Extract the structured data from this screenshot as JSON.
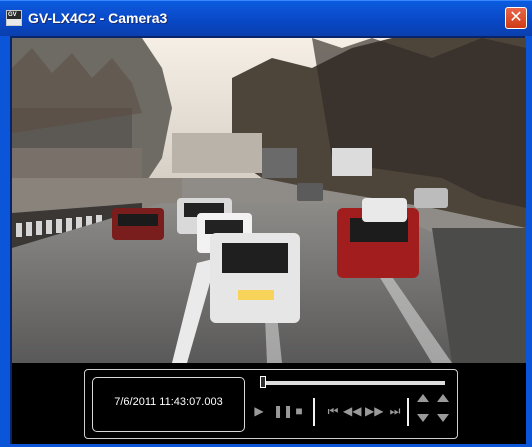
{
  "window": {
    "title": "GV-LX4C2 - Camera3",
    "icon_label": "GV",
    "close_glyph": "✕"
  },
  "video": {
    "description_icon": "video-feed"
  },
  "controls": {
    "timestamp": "7/6/2011 11:43:07.003",
    "progress_fraction": 0.0,
    "buttons": {
      "play": "▶",
      "pause": "❚❚",
      "stop": "■",
      "first_frame": "⏮",
      "rewind": "◀◀",
      "fast_forward": "▶▶",
      "last_frame": "⏭"
    }
  },
  "colors": {
    "titlebar": "#0a5ce0",
    "close_button": "#d94a2a",
    "control_text": "#ffffff"
  }
}
